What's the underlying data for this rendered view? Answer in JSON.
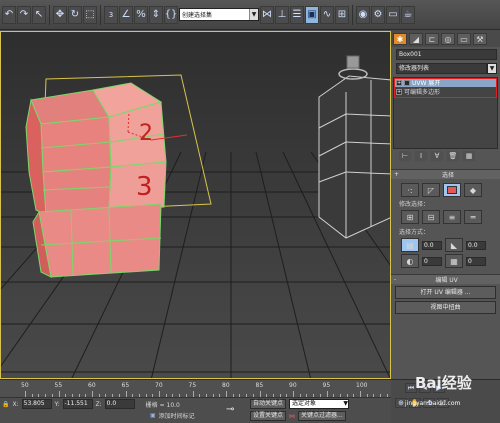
{
  "toolbar": {
    "selection_set": "创建选择集",
    "icons": [
      "undo-icon",
      "redo-icon",
      "select-icon",
      "select-region-icon",
      "move-icon",
      "rotate-icon",
      "scale-icon",
      "snap-3-icon",
      "angle-snap-icon",
      "percent-snap-icon",
      "spinner-snap-icon",
      "edit-named-selection-icon",
      "mirror-icon",
      "align-icon",
      "layer-icon",
      "graphite-icon",
      "curve-editor-icon",
      "schematic-icon",
      "material-editor-icon",
      "render-setup-icon",
      "render-frame-icon",
      "render-icon"
    ]
  },
  "viewport": {
    "annotations": [
      "2",
      "3"
    ]
  },
  "panel": {
    "object_name": "Box001",
    "modifier_list_label": "修改器列表",
    "stack": [
      {
        "label": "UVW 展开",
        "selected": true
      },
      {
        "label": "可编辑多边形",
        "selected": false
      }
    ],
    "selection_rollout": "选择",
    "modify_selection_label": "修改选择：",
    "select_by_label": "选择方式：",
    "spin_values": [
      "0.0",
      "0",
      "0"
    ],
    "edit_uv_rollout": "编辑 UV",
    "open_uv_editor": "打开 UV 编辑器 ...",
    "view_align": "视图中扭曲"
  },
  "timeline": {
    "ticks": [
      "50",
      "55",
      "60",
      "65",
      "70",
      "75",
      "80",
      "85",
      "90",
      "95",
      "100"
    ]
  },
  "status": {
    "x_label": "X:",
    "x_value": "53.805",
    "y_label": "Y:",
    "y_value": "-11.551",
    "z_label": "Z:",
    "z_value": "0.0",
    "grid": "栅格 = 10.0",
    "add_time_tag": "添加时间标记",
    "auto_key": "自动关键点",
    "selected_object": "选定对象",
    "set_key": "设置关键点",
    "key_filters": "关键点过滤器..."
  },
  "watermark": {
    "brand": "经验",
    "url": "jingyan.baidu.com"
  }
}
